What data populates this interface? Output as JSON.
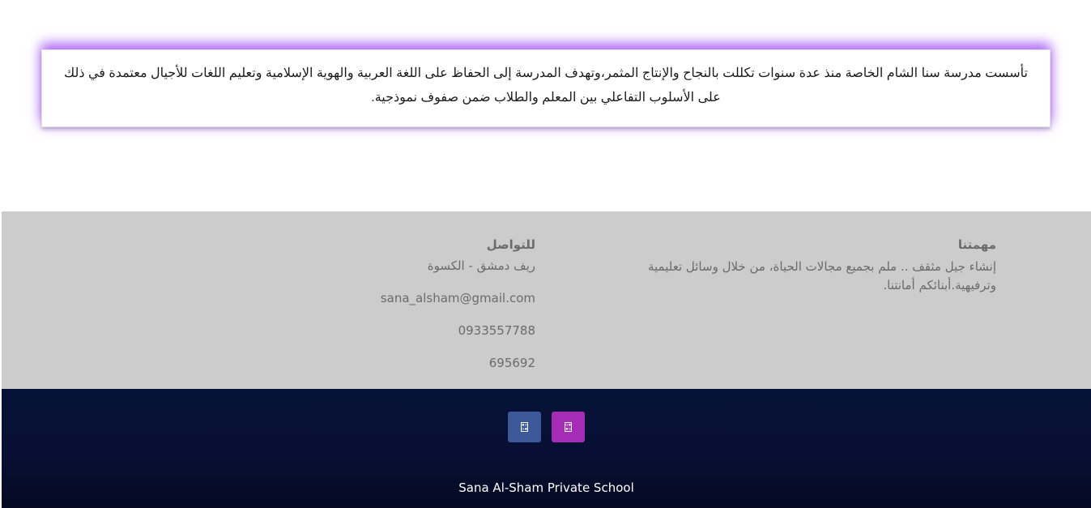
{
  "about": {
    "text": "تأسست مدرسة سنا الشام الخاصة منذ عدة سنوات تكللت بالنجاح والإنتاج المثمر،وتهدف المدرسة إلى الحفاظ على اللغة العربية والهوية الإسلامية وتعليم اللغات للأجيال معتمدة في ذلك على الأسلوب التفاعلي بين المعلم والطلاب ضمن صفوف نموذجية."
  },
  "mission": {
    "title": "مهمتنا",
    "text": "إنشاء جيل مثقف .. ملم بجميع مجالات الحياة، من خلال وسائل تعليمية وترفيهية.أبنائكم أمانتنا."
  },
  "contact": {
    "title": "للتواصل",
    "address": "ريف دمشق - الكسوة",
    "email": "sana_alsham@gmail.com",
    "phone": "0933557788",
    "landline": "695692"
  },
  "footer": {
    "social": [
      {
        "name": "facebook",
        "icon": "facebook-icon",
        "color": "#3b5998"
      },
      {
        "name": "instagram",
        "icon": "instagram-icon",
        "color": "#a52cb5"
      }
    ],
    "copyright": "Sana Al-Sham Private School"
  },
  "colors": {
    "card_glow": "#a85ff5",
    "info_background": "#cccccc",
    "footer_background": "#071238"
  }
}
